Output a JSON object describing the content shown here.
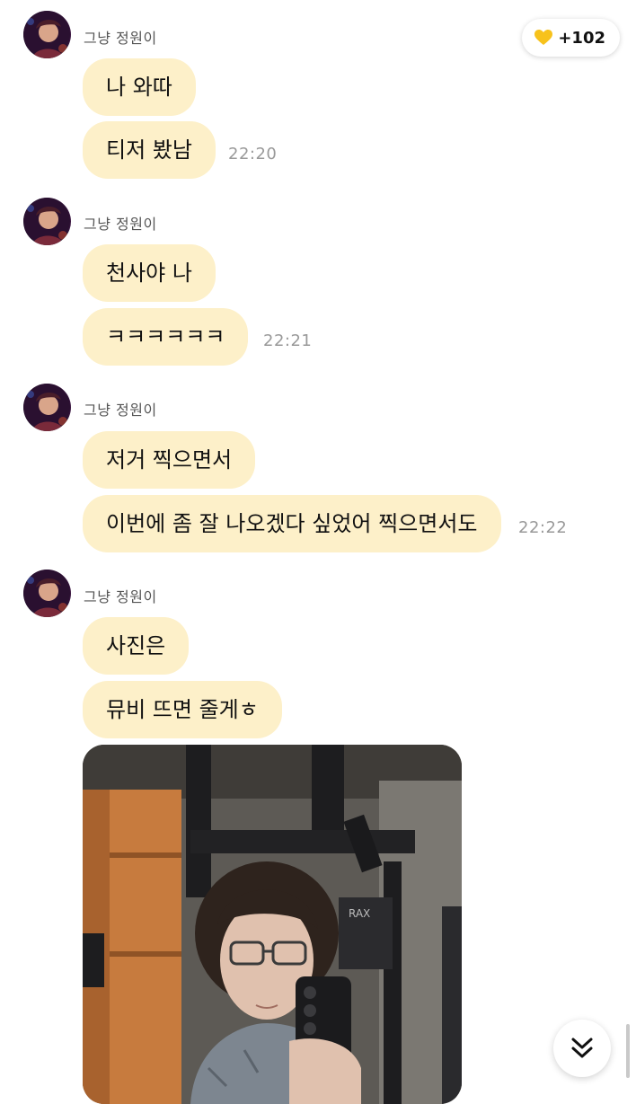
{
  "reaction": {
    "icon": "yellow-heart-icon",
    "count": "+102",
    "color": "#f7c21c"
  },
  "bubble_color": "#fdf0c9",
  "groups": [
    {
      "sender": "그냥 정원이",
      "messages": [
        "나 와따",
        "티저 봤남"
      ],
      "time": "22:20"
    },
    {
      "sender": "그냥 정원이",
      "messages": [
        "천사야 나",
        "ㅋㅋㅋㅋㅋㅋ"
      ],
      "time": "22:21"
    },
    {
      "sender": "그냥 정원이",
      "messages": [
        "저거 찍으면서",
        "이번에 좀 잘 나오겠다 싶었어 찍으면서도"
      ],
      "time": "22:22"
    },
    {
      "sender": "그냥 정원이",
      "messages": [
        "사진은",
        "뮤비 뜨면 줄게ㅎ"
      ]
    }
  ],
  "photo": {
    "icon": "photo-selfie-image",
    "gym_sign": "RAX"
  },
  "scroll_button": {
    "icon": "double-chevron-down-icon"
  }
}
